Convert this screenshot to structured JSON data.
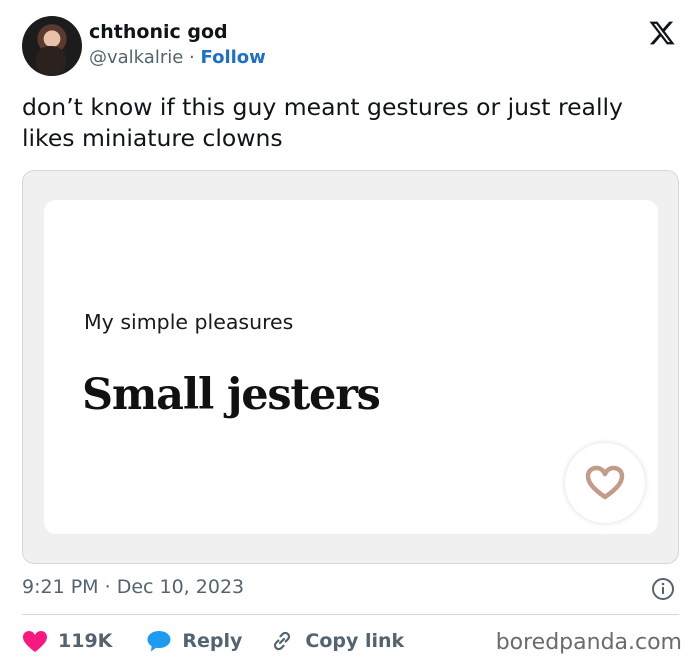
{
  "author": {
    "name": "chthonic god",
    "handle": "@valkalrie",
    "separator": "·",
    "follow_label": "Follow"
  },
  "tweet": {
    "text": "don’t know if this guy meant gestures or just really likes miniature clowns"
  },
  "media_card": {
    "prompt": "My simple pleasures",
    "answer": "Small jesters"
  },
  "meta": {
    "time": "9:21 PM",
    "separator": "·",
    "date": "Dec 10, 2023"
  },
  "actions": {
    "likes_count": "119K",
    "reply_label": "Reply",
    "copy_link_label": "Copy link"
  },
  "watermark": "boredpanda.com",
  "colors": {
    "link_blue": "#1d70c9",
    "like_red": "#f91880",
    "reply_blue": "#1d9bf0",
    "muted_text": "#536471",
    "card_heart": "#c49a8a"
  },
  "icons": [
    "avatar-photo",
    "x-logo-icon",
    "heart-outline-icon",
    "info-icon",
    "heart-filled-icon",
    "speech-bubble-icon",
    "link-icon"
  ]
}
